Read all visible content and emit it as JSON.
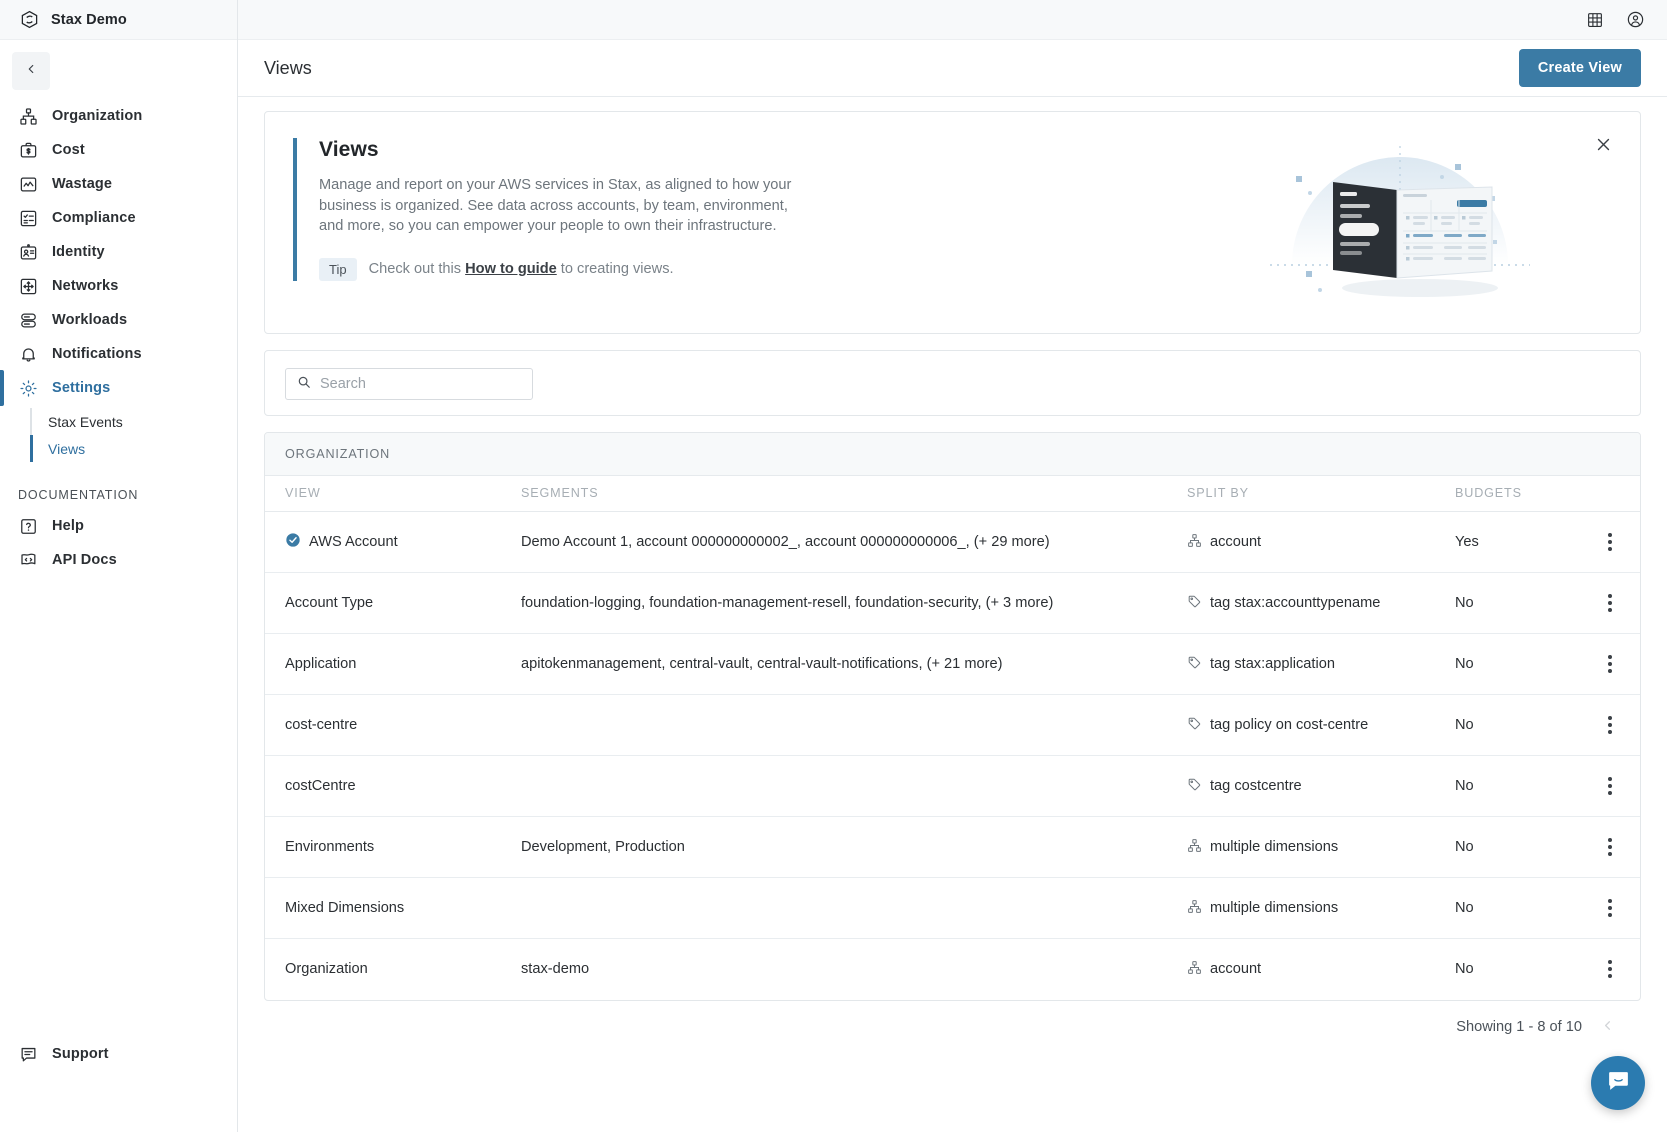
{
  "brand": {
    "name": "Stax Demo",
    "logo_icon": "stax-logo-icon"
  },
  "topbar": {
    "grid_icon": "grid-apps-icon",
    "account_icon": "user-account-icon"
  },
  "sidebar": {
    "collapse_icon": "chevron-left-icon",
    "items": [
      {
        "label": "Organization",
        "icon": "organization-icon"
      },
      {
        "label": "Cost",
        "icon": "cost-icon"
      },
      {
        "label": "Wastage",
        "icon": "wastage-icon"
      },
      {
        "label": "Compliance",
        "icon": "compliance-icon"
      },
      {
        "label": "Identity",
        "icon": "identity-icon"
      },
      {
        "label": "Networks",
        "icon": "networks-icon"
      },
      {
        "label": "Workloads",
        "icon": "workloads-icon"
      },
      {
        "label": "Notifications",
        "icon": "bell-icon"
      },
      {
        "label": "Settings",
        "icon": "gear-icon"
      }
    ],
    "subitems": [
      {
        "label": "Stax Events"
      },
      {
        "label": "Views"
      }
    ],
    "documentation_label": "DOCUMENTATION",
    "doc_items": [
      {
        "label": "Help",
        "icon": "help-icon"
      },
      {
        "label": "API Docs",
        "icon": "api-docs-icon"
      }
    ],
    "support": {
      "label": "Support",
      "icon": "support-chat-icon"
    }
  },
  "page": {
    "title": "Views",
    "create_button": "Create View"
  },
  "banner": {
    "title": "Views",
    "description": "Manage and report on your AWS services in Stax, as aligned to how your business is organized. See data across accounts, by team, environment, and more, so you can empower your people to own their infrastructure.",
    "tip_badge": "Tip",
    "tip_prefix": "Check out this",
    "tip_link": "How to guide",
    "tip_suffix": "to creating views.",
    "close_icon": "close-icon",
    "illustration_icon": "dashboard-illustration"
  },
  "search": {
    "placeholder": "Search",
    "value": "",
    "icon": "search-icon"
  },
  "table": {
    "group_header": "ORGANIZATION",
    "columns": [
      "VIEW",
      "SEGMENTS",
      "SPLIT BY",
      "BUDGETS"
    ],
    "rows": [
      {
        "view": "AWS Account",
        "verified": true,
        "segments": "Demo Account 1, account 000000000002_, account 000000000006_, (+ 29 more)",
        "split_by": "account",
        "split_icon": "dimension-icon",
        "budgets": "Yes"
      },
      {
        "view": "Account Type",
        "verified": false,
        "segments": "foundation-logging, foundation-management-resell, foundation-security, (+ 3 more)",
        "split_by": "tag stax:accounttypename",
        "split_icon": "tag-icon",
        "budgets": "No"
      },
      {
        "view": "Application",
        "verified": false,
        "segments": "apitokenmanagement, central-vault, central-vault-notifications, (+ 21 more)",
        "split_by": "tag stax:application",
        "split_icon": "tag-icon",
        "budgets": "No"
      },
      {
        "view": "cost-centre",
        "verified": false,
        "segments": "",
        "split_by": "tag policy on cost-centre",
        "split_icon": "tag-icon",
        "budgets": "No"
      },
      {
        "view": "costCentre",
        "verified": false,
        "segments": "",
        "split_by": "tag costcentre",
        "split_icon": "tag-icon",
        "budgets": "No"
      },
      {
        "view": "Environments",
        "verified": false,
        "segments": "Development, Production",
        "split_by": "multiple dimensions",
        "split_icon": "dimension-icon",
        "budgets": "No"
      },
      {
        "view": "Mixed Dimensions",
        "verified": false,
        "segments": "",
        "split_by": "multiple dimensions",
        "split_icon": "dimension-icon",
        "budgets": "No"
      },
      {
        "view": "Organization",
        "verified": false,
        "segments": "stax-demo",
        "split_by": "account",
        "split_icon": "dimension-icon",
        "budgets": "No"
      }
    ],
    "row_menu_icon": "kebab-menu-icon",
    "pagination": "Showing 1 - 8 of 10",
    "prev_icon": "chevron-left-icon"
  },
  "chat_widget": {
    "icon": "chat-bubble-icon"
  },
  "colors": {
    "accent": "#3b7ba5",
    "accent_dark": "#2f6f9f",
    "chat": "#2b7bb0",
    "text": "#2b2f33",
    "muted": "#6d757c",
    "border": "#e3e7ea"
  }
}
